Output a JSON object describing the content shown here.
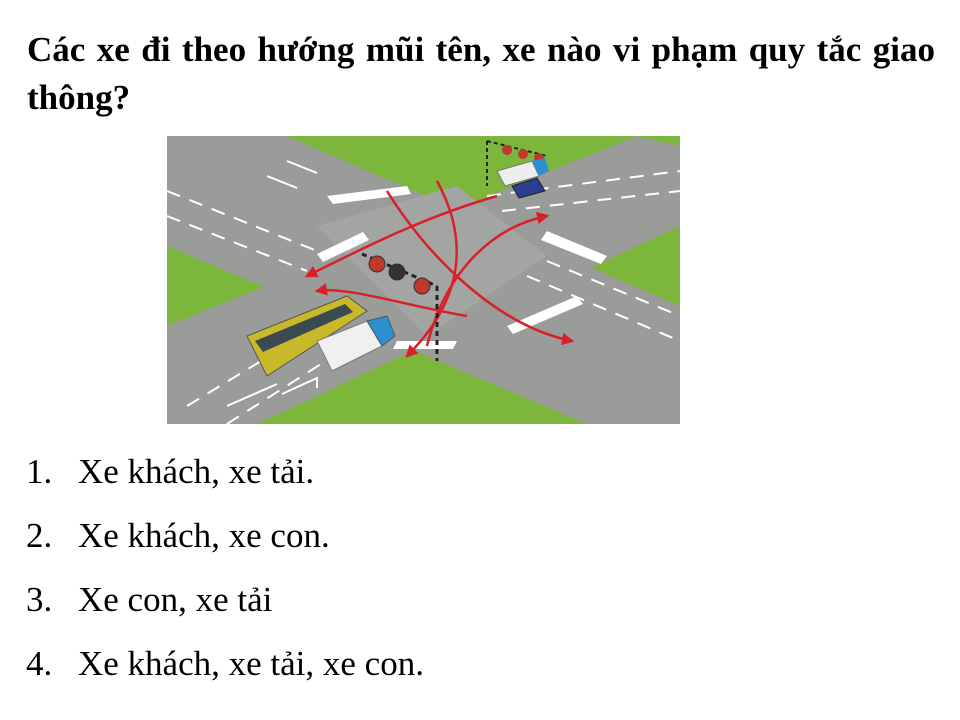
{
  "question": {
    "text": "Các xe đi theo hướng mũi tên, xe nào vi phạm quy tắc giao thông?"
  },
  "figure": {
    "description_icon": "intersection-illustration",
    "colors": {
      "grass": "#7cb63a",
      "road": "#9a9c9a",
      "lane_marking": "#ffffff",
      "arrow": "#d8202a",
      "bus": "#c9b92a",
      "truck_body": "#f0f0f0",
      "truck_cab": "#2c8fd0",
      "car": "#2a3f8f",
      "traffic_light_red": "#c0392b"
    }
  },
  "answers": [
    {
      "number": "1.",
      "text": "Xe khách, xe tải."
    },
    {
      "number": "2.",
      "text": "Xe khách, xe con."
    },
    {
      "number": "3.",
      "text": "Xe con, xe tải"
    },
    {
      "number": "4.",
      "text": "Xe khách, xe tải, xe con."
    }
  ]
}
